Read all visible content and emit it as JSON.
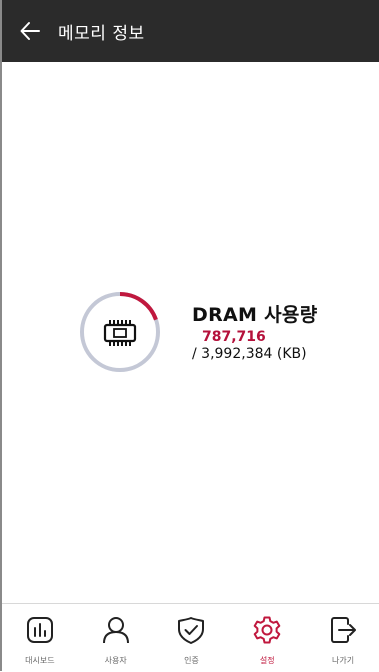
{
  "header": {
    "title": "메모리 정보",
    "back_icon": "arrow-left-icon"
  },
  "memory": {
    "title": "DRAM 사용량",
    "used": "787,716",
    "total": "/ 3,992,384 (KB)",
    "usage_fraction": 0.197,
    "icon": "memory-chip-icon"
  },
  "colors": {
    "header_bg": "#2b2b2b",
    "accent": "#c0183e",
    "gauge_track": "#c4c8d6",
    "used_text": "#b5113b"
  },
  "bottom_nav": {
    "items": [
      {
        "label": "대시보드",
        "icon": "dashboard-icon",
        "active": false
      },
      {
        "label": "사용자",
        "icon": "user-icon",
        "active": false
      },
      {
        "label": "인증",
        "icon": "shield-check-icon",
        "active": false
      },
      {
        "label": "설정",
        "icon": "gear-icon",
        "active": true
      },
      {
        "label": "나가기",
        "icon": "exit-icon",
        "active": false
      }
    ]
  }
}
